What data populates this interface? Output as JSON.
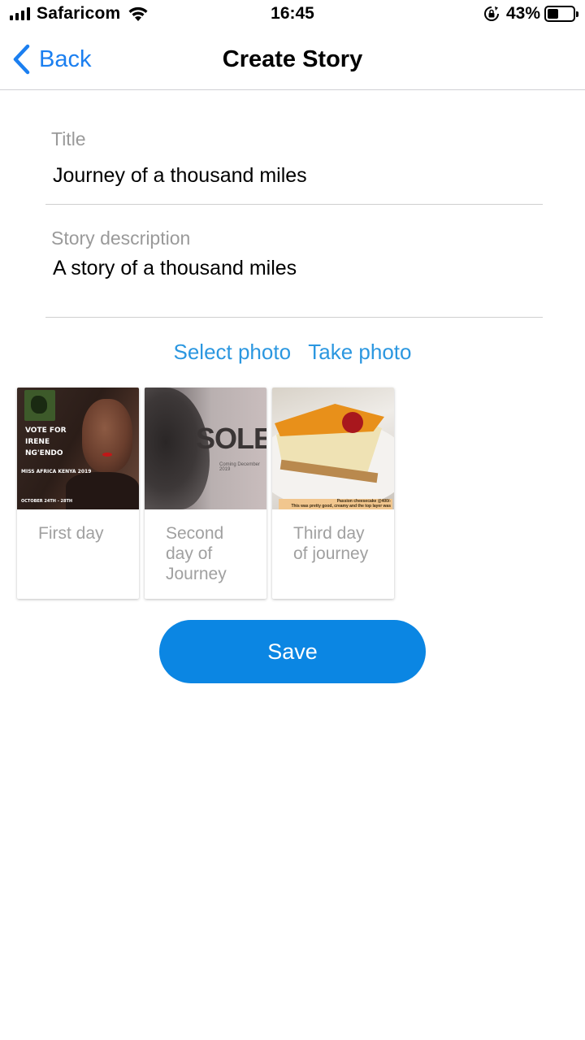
{
  "status_bar": {
    "carrier": "Safaricom",
    "time": "16:45",
    "battery_percent": "43%",
    "battery_level": 0.43,
    "icons": [
      "signal-icon",
      "wifi-icon",
      "rotation-lock-icon",
      "battery-icon"
    ]
  },
  "nav": {
    "back_label": "Back",
    "title": "Create Story",
    "accent_color": "#1b7ff0"
  },
  "form": {
    "title_label": "Title",
    "title_value": "Journey of a thousand miles",
    "description_label": "Story description",
    "description_value": "A story of a thousand miles"
  },
  "photo_actions": {
    "select_photo": "Select photo",
    "take_photo": "Take photo",
    "link_color": "#2b97e0"
  },
  "photos": [
    {
      "caption": "First day",
      "image_text": {
        "vote": "VOTE FOR",
        "name_1": "IRENE",
        "name_2": "NG'ENDO",
        "event": "MISS AFRICA KENYA 2019",
        "dates": "OCTOBER 24TH - 28TH"
      }
    },
    {
      "caption": "Second day of Journey",
      "image_text": {
        "headline": "SOLEi",
        "subline": "Coming December 2019"
      }
    },
    {
      "caption": "Third day of journey",
      "image_text": {
        "label_1": "Passion cheesecake @400/-",
        "label_2": "This was pretty good, creamy and the top layer was"
      }
    }
  ],
  "save_button": {
    "label": "Save",
    "color": "#0b86e3"
  }
}
